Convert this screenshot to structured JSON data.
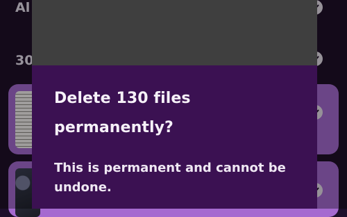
{
  "background": {
    "filter_label": "Al",
    "section_label": "30"
  },
  "dialog": {
    "title": "Delete 130 files permanently?",
    "message": "This is permanent and cannot be undone."
  },
  "colors": {
    "dialog_background": "#3b1152",
    "preview_area": "#3f3f3f",
    "card_accent": "#a56ad0",
    "app_background": "#1f1029"
  },
  "icons": {
    "selection": "check-circle-icon"
  }
}
